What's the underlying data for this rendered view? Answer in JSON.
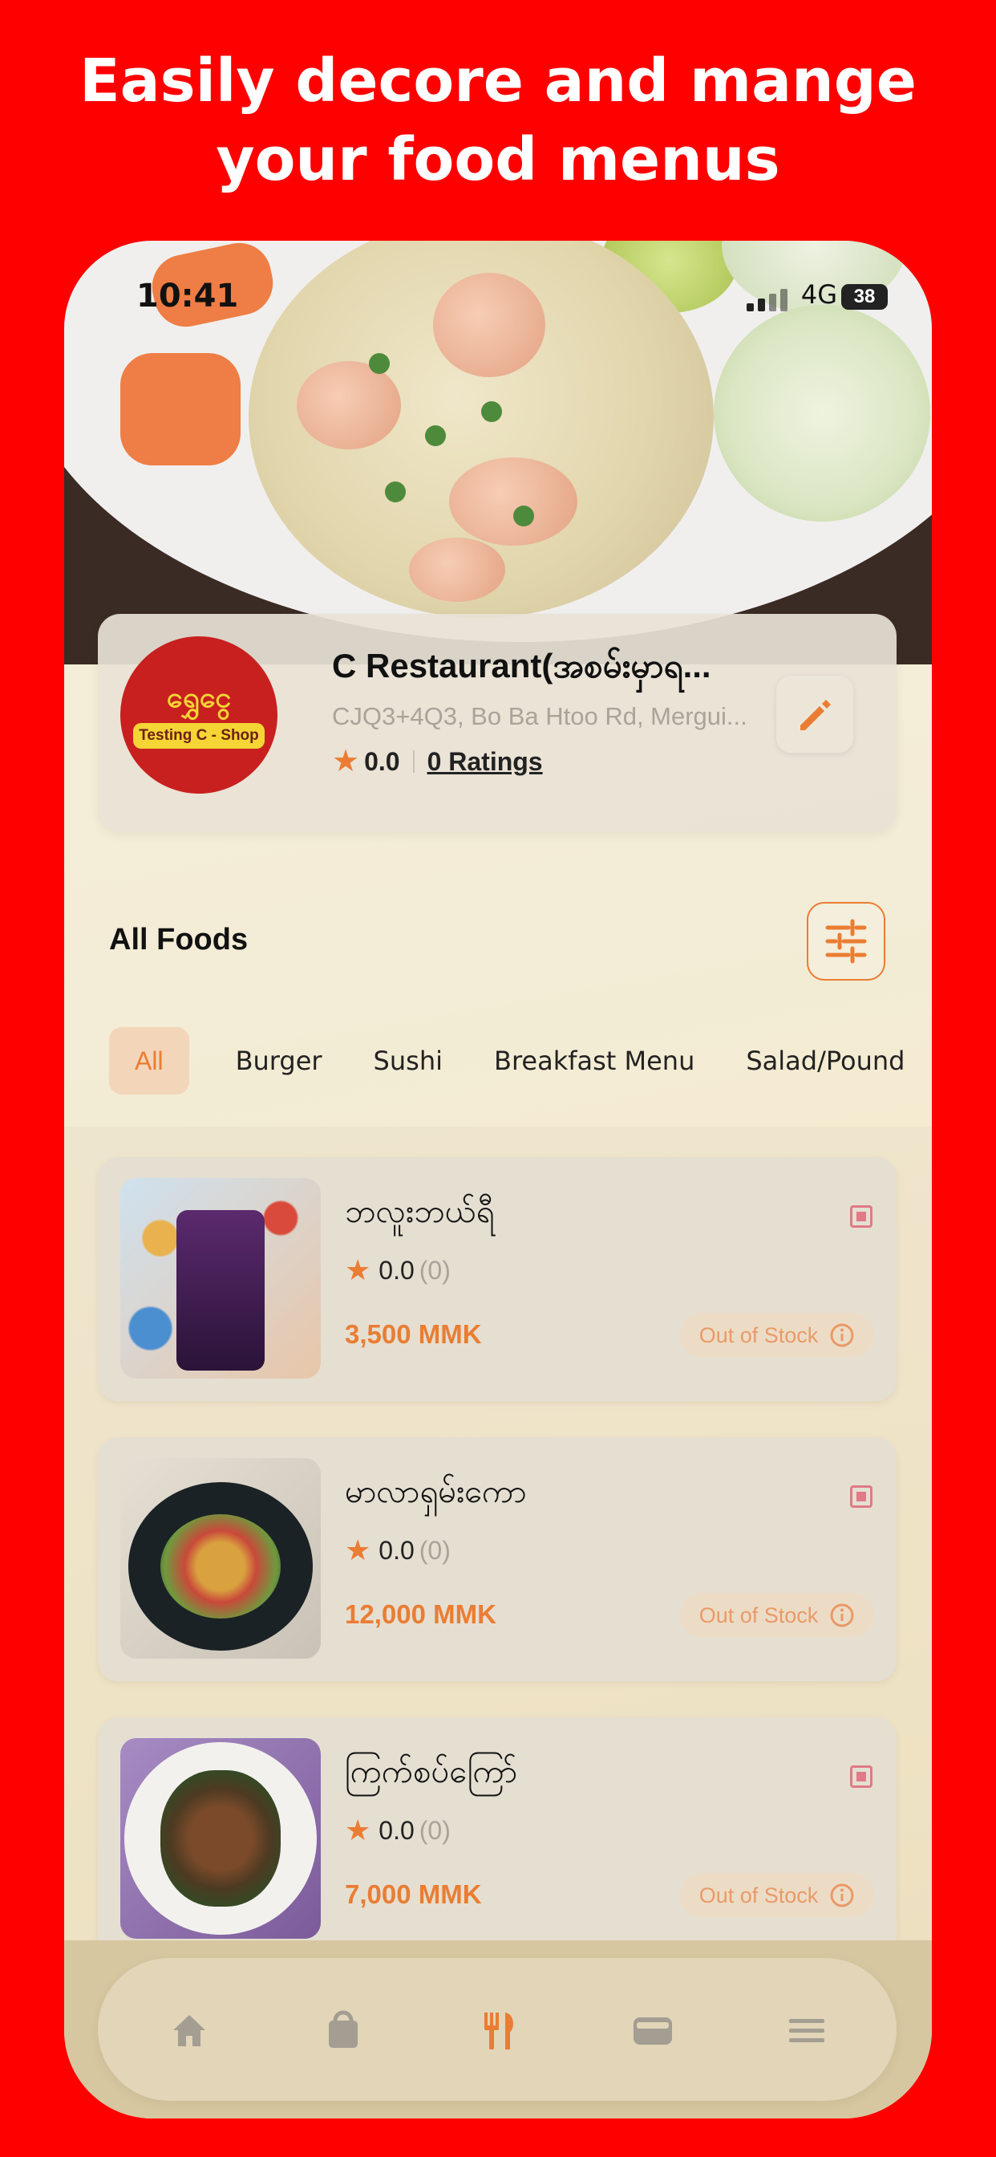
{
  "headline": {
    "line1": "Easily decore and mange",
    "line2": "your food menus"
  },
  "status_bar": {
    "time": "10:41",
    "network": "4G",
    "battery": "38"
  },
  "restaurant": {
    "logo_text": "ရွှေငွေ",
    "logo_band": "Testing C - Shop",
    "name": "C Restaurant(အစမ်းမှာရ...",
    "address": "CJQ3+4Q3, Bo Ba Htoo Rd, Mergui...",
    "rating": "0.0",
    "ratings_link": "0 Ratings"
  },
  "section": {
    "title": "All Foods"
  },
  "categories": [
    {
      "label": "All",
      "active": true
    },
    {
      "label": "Burger",
      "active": false
    },
    {
      "label": "Sushi",
      "active": false
    },
    {
      "label": "Breakfast Menu",
      "active": false
    },
    {
      "label": "Salad/Pound",
      "active": false
    }
  ],
  "foods": [
    {
      "name": "ဘလူးဘယ်ရီ",
      "rating": "0.0",
      "count": "(0)",
      "price": "3,500 MMK",
      "stock": "Out of Stock"
    },
    {
      "name": "မာလာရှမ်းကော",
      "rating": "0.0",
      "count": "(0)",
      "price": "12,000 MMK",
      "stock": "Out of Stock"
    },
    {
      "name": "ကြက်စပ်ကြော်",
      "rating": "0.0",
      "count": "(0)",
      "price": "7,000 MMK",
      "stock": "Out of Stock"
    }
  ],
  "colors": {
    "background": "#fe0000",
    "accent": "#ea7d33",
    "checkbox": "#e07a86"
  },
  "nav": {
    "icons": [
      "home-icon",
      "shopping-bag-icon",
      "restaurant-icon",
      "wallet-icon",
      "menu-icon"
    ],
    "active": "restaurant-icon"
  }
}
